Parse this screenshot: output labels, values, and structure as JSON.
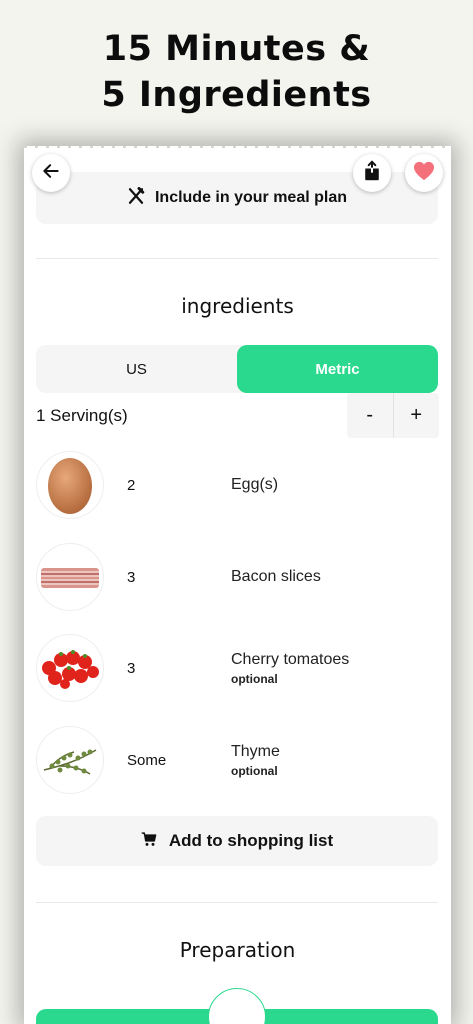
{
  "promo": {
    "line1": "15 Minutes &",
    "line2": "5 Ingredients"
  },
  "header": {
    "back_icon": "arrow-left-icon",
    "share_icon": "share-icon",
    "favorite_icon": "heart-icon",
    "favorite_color": "#f4707a"
  },
  "meal_plan": {
    "label": "Include in your meal plan",
    "icon": "fork-knife-icon"
  },
  "ingredients": {
    "title": "ingredients",
    "units": {
      "us_label": "US",
      "metric_label": "Metric",
      "selected": "Metric"
    },
    "servings_label": "1 Serving(s)",
    "stepper": {
      "minus": "-",
      "plus": "+"
    },
    "items": [
      {
        "qty": "2",
        "name": "Egg(s)",
        "note": ""
      },
      {
        "qty": "3",
        "name": "Bacon slices",
        "note": ""
      },
      {
        "qty": "3",
        "name": "Cherry tomatoes",
        "note": "optional"
      },
      {
        "qty": "Some",
        "name": "Thyme",
        "note": "optional"
      }
    ]
  },
  "shopping": {
    "label": "Add to shopping list",
    "icon": "cart-icon"
  },
  "preparation": {
    "title": "Preparation"
  },
  "colors": {
    "accent": "#2ad98d",
    "background": "#f4f4ef",
    "button_bg": "#f5f5f5"
  }
}
